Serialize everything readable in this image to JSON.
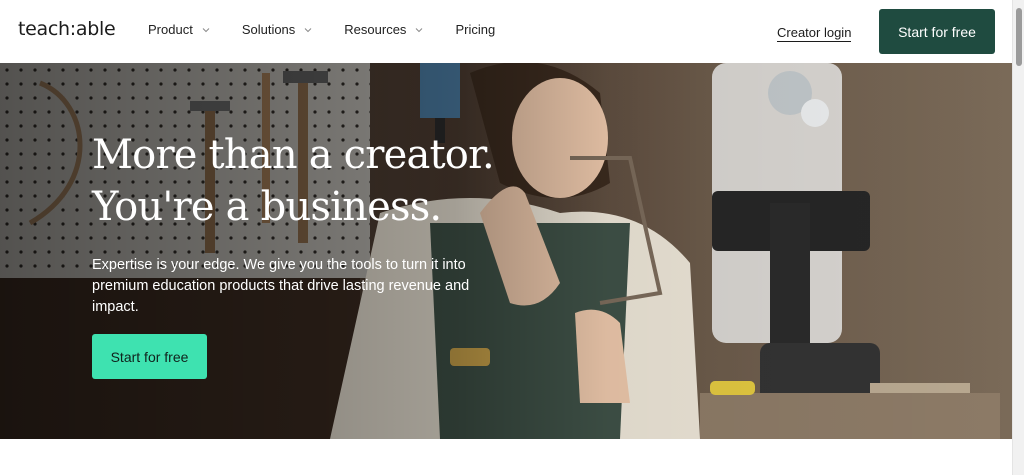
{
  "header": {
    "logo": "teach:able",
    "nav": [
      {
        "label": "Product",
        "dropdown": true
      },
      {
        "label": "Solutions",
        "dropdown": true
      },
      {
        "label": "Resources",
        "dropdown": true
      },
      {
        "label": "Pricing",
        "dropdown": false
      }
    ],
    "login_label": "Creator login",
    "cta_label": "Start for free"
  },
  "hero": {
    "headline_line1": "More than a creator.",
    "headline_line2": "You're a business.",
    "subtext": "Expertise is your edge. We give you the tools to turn it into premium education products that drive lasting revenue and impact.",
    "cta_label": "Start for free"
  },
  "colors": {
    "brand_dark": "#1f4b40",
    "accent": "#3ee2b0"
  }
}
